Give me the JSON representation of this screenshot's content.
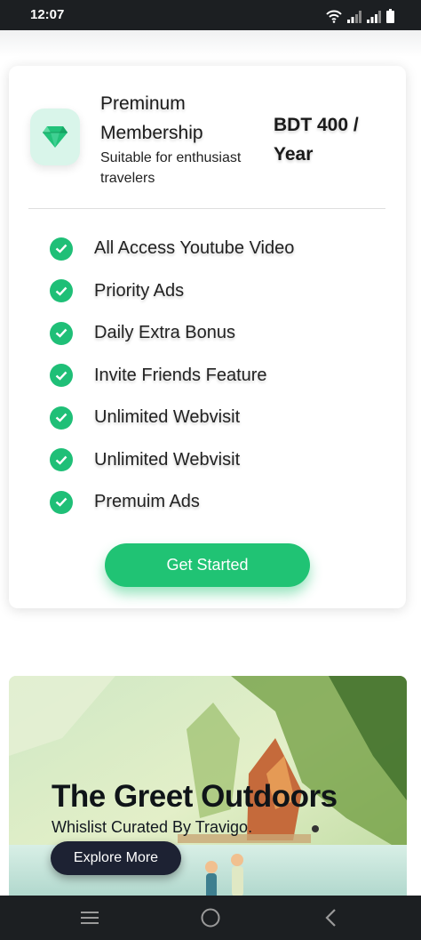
{
  "status_bar": {
    "time": "12:07",
    "icons": [
      "wifi-icon",
      "signal-icon",
      "signal-icon",
      "battery-icon"
    ]
  },
  "membership": {
    "icon": "gem-icon",
    "title": "Preminum Membership",
    "subtitle": "Suitable for enthusiast travelers",
    "price": "BDT 400 / Year",
    "features": [
      "All Access Youtube Video",
      "Priority Ads",
      "Daily Extra Bonus",
      "Invite Friends Feature",
      "Unlimited Webvisit",
      "Unlimited Webvisit",
      "Premuim Ads"
    ],
    "cta_label": "Get Started"
  },
  "promo": {
    "title": "The Greet Outdoors",
    "subtitle": "Whislist Curated By Travigo.",
    "button_label": "Explore More"
  },
  "nav_bar": {
    "icons": [
      "menu-icon",
      "home-icon",
      "back-icon"
    ]
  },
  "colors": {
    "accent": "#20c374",
    "dark": "#1c1f22",
    "button_dark": "#1d2233"
  }
}
